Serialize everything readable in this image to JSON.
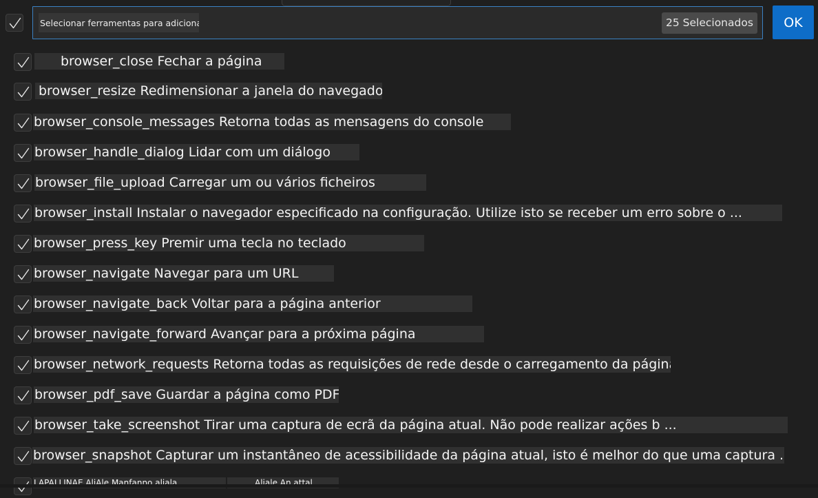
{
  "search": {
    "placeholder": "Selecionar ferramentas para adicionar",
    "selected_count_label": "25 Selecionados"
  },
  "ok_label": "OK",
  "tools": [
    {
      "text": "browser_close Fechar a página",
      "checked": true
    },
    {
      "text": "browser_resize Redimensionar a janela do navegador",
      "checked": true
    },
    {
      "text": "browser_console_messages Retorna todas as mensagens do console",
      "checked": true
    },
    {
      "text": "browser_handle_dialog Lidar com um diálogo",
      "checked": true
    },
    {
      "text": "browser_file_upload Carregar um ou vários ficheiros",
      "checked": true
    },
    {
      "text": "browser_install Instalar o navegador especificado na configuração. Utilize isto se receber um erro sobre o ...",
      "checked": true
    },
    {
      "text": "browser_press_key Premir uma tecla no teclado",
      "checked": true
    },
    {
      "text": "browser_navigate Navegar para um URL",
      "checked": true
    },
    {
      "text": "browser_navigate_back Voltar para a página anterior",
      "checked": true
    },
    {
      "text": "browser_navigate_forward Avançar para a próxima página",
      "checked": true
    },
    {
      "text": "browser_network_requests Retorna todas as requisições de rede desde o carregamento da página",
      "checked": true
    },
    {
      "text": "browser_pdf_save Guardar a página como PDF",
      "checked": true
    },
    {
      "text": "browser_take_screenshot Tirar uma captura de ecrã da página atual. Não pode realizar ações b ...",
      "checked": true
    },
    {
      "text": "browser_snapshot Capturar um instantâneo de acessibilidade da página atual, isto é melhor do que uma captura ...",
      "checked": true
    },
    {
      "text": "LAPALLINAE AliAle Manfanno aliala",
      "checked": true
    },
    {
      "text": "Aliale An attal",
      "checked": true
    }
  ]
}
